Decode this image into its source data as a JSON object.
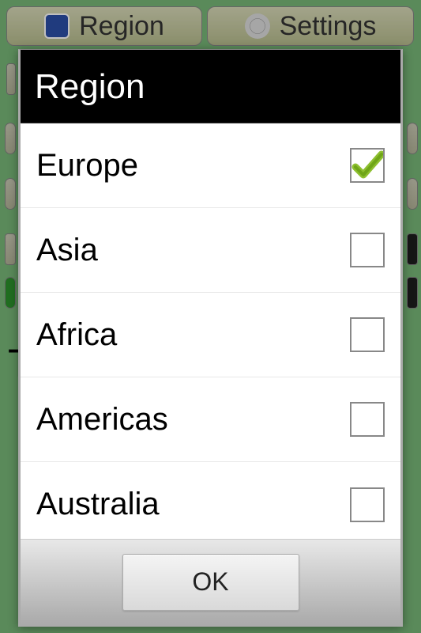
{
  "background": {
    "region_label": "Region",
    "settings_label": "Settings"
  },
  "dialog": {
    "title": "Region",
    "items": [
      {
        "label": "Europe",
        "checked": true
      },
      {
        "label": "Asia",
        "checked": false
      },
      {
        "label": "Africa",
        "checked": false
      },
      {
        "label": "Americas",
        "checked": false
      },
      {
        "label": "Australia",
        "checked": false
      }
    ],
    "ok_label": "OK"
  }
}
